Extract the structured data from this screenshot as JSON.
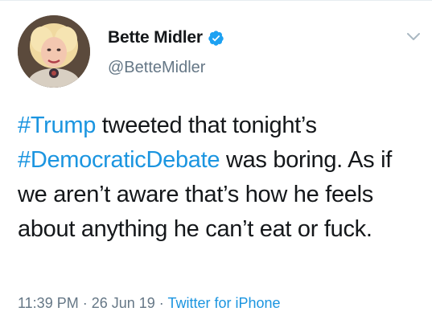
{
  "user": {
    "display_name": "Bette Midler",
    "handle": "@BetteMidler",
    "verified": true
  },
  "tweet": {
    "segments": [
      {
        "text": "#Trump",
        "type": "hashtag"
      },
      {
        "text": " tweeted that tonight’s ",
        "type": "text"
      },
      {
        "text": "#DemocraticDebate",
        "type": "hashtag"
      },
      {
        "text": " was boring. As if we aren’t aware that’s how he feels about anything he can’t eat or fuck.",
        "type": "text"
      }
    ]
  },
  "meta": {
    "time": "11:39 PM",
    "separator": " · ",
    "date": "26 Jun 19",
    "source": "Twitter for iPhone"
  },
  "icons": {
    "verified": "verified-badge-icon",
    "menu": "chevron-down-icon"
  },
  "colors": {
    "link": "#1b95e0",
    "secondary_text": "#657786",
    "primary_text": "#14171a"
  }
}
